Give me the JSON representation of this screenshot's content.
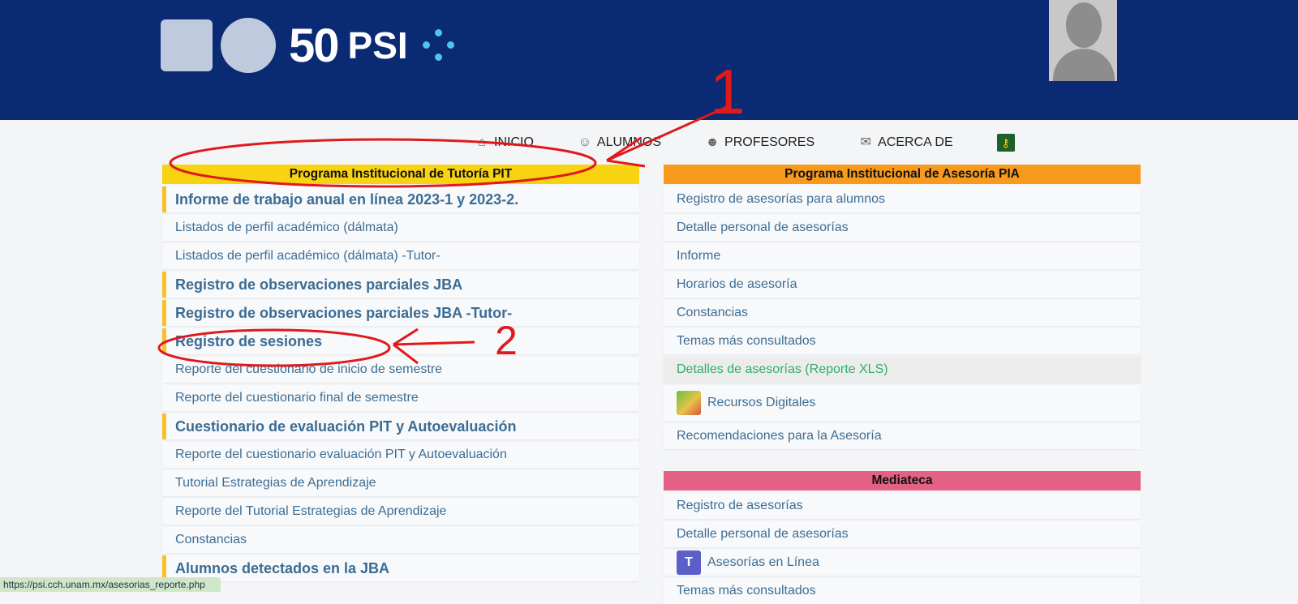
{
  "header": {
    "logo_text": "50",
    "app_name": "PSI",
    "user_caption": ""
  },
  "nav": {
    "items": [
      {
        "label": "INICIO",
        "icon": "home-icon"
      },
      {
        "label": "ALUMNOS",
        "icon": "student-icon"
      },
      {
        "label": "PROFESORES",
        "icon": "teacher-icon"
      },
      {
        "label": "ACERCA DE",
        "icon": "mail-icon"
      }
    ],
    "key_icon": "key-icon"
  },
  "pit": {
    "title": "Programa Institucional de Tutoría PIT",
    "items": [
      {
        "label": "Informe de trabajo anual en línea 2023-1 y 2023-2.",
        "bold": true
      },
      {
        "label": "Listados de perfil académico (dálmata)",
        "bold": false
      },
      {
        "label": "Listados de perfil académico (dálmata) -Tutor-",
        "bold": false
      },
      {
        "label": "Registro de observaciones parciales JBA",
        "bold": true
      },
      {
        "label": "Registro de observaciones parciales JBA -Tutor-",
        "bold": true
      },
      {
        "label": "Registro de sesiones",
        "bold": true
      },
      {
        "label": "Reporte del cuestionario de inicio de semestre",
        "bold": false
      },
      {
        "label": "Reporte del cuestionario final de semestre",
        "bold": false
      },
      {
        "label": "Cuestionario de evaluación PIT y Autoevaluación",
        "bold": true
      },
      {
        "label": "Reporte del cuestionario evaluación PIT y Autoevaluación",
        "bold": false
      },
      {
        "label": "Tutorial Estrategias de Aprendizaje",
        "bold": false
      },
      {
        "label": "Reporte del Tutorial Estrategias de Aprendizaje",
        "bold": false
      },
      {
        "label": "Constancias",
        "bold": false
      },
      {
        "label": "Alumnos detectados en la JBA",
        "bold": true
      }
    ]
  },
  "pia": {
    "title": "Programa Institucional de Asesoría PIA",
    "items": [
      {
        "label": "Registro de asesorías para alumnos"
      },
      {
        "label": "Detalle personal de asesorías"
      },
      {
        "label": "Informe"
      },
      {
        "label": "Horarios de asesoría"
      },
      {
        "label": "Constancias"
      },
      {
        "label": "Temas más consultados"
      },
      {
        "label": "Detalles de asesorías (Reporte XLS)",
        "highlight": true
      },
      {
        "label": "Recursos Digitales",
        "icon": "digital-resources-icon"
      },
      {
        "label": "Recomendaciones para la Asesoría"
      }
    ]
  },
  "mediateca": {
    "title": "Mediateca",
    "items": [
      {
        "label": "Registro de asesorías"
      },
      {
        "label": "Detalle personal de asesorías"
      },
      {
        "label": "Asesorías en Línea",
        "icon": "teams-icon"
      },
      {
        "label": "Temas más consultados"
      }
    ]
  },
  "annotations": {
    "one": "1",
    "two": "2"
  },
  "status_bar": {
    "url": "https://psi.cch.unam.mx/asesorias_reporte.php"
  },
  "colors": {
    "header_bg": "#0a2a73",
    "pit_header": "#f8d311",
    "pia_header": "#f79a1e",
    "mediateca_header": "#e36185",
    "link_text": "#3d6d93",
    "annotation": "#e0191b"
  }
}
